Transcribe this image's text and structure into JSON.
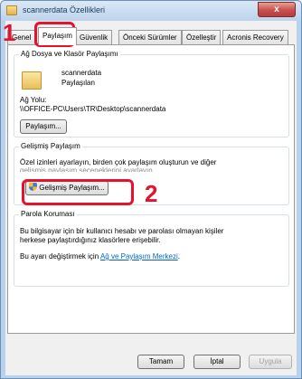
{
  "window": {
    "title": "scannerdata Özellikleri",
    "close_symbol": "x"
  },
  "tabs": [
    "Genel",
    "Paylaşım",
    "Güvenlik",
    "Önceki Sürümler",
    "Özelleştir",
    "Acronis Recovery"
  ],
  "network_share": {
    "group_title": "Ağ Dosya ve Klasör Paylaşımı",
    "folder_name": "scannerdata",
    "folder_status": "Paylaşılan",
    "path_label": "Ağ Yolu:",
    "path_value": "\\\\OFFICE-PC\\Users\\TR\\Desktop\\scannerdata",
    "share_button": "Paylaşım..."
  },
  "advanced_share": {
    "group_title": "Gelişmiş Paylaşım",
    "description_1": "Özel izinleri ayarlayın, birden çok paylaşım oluşturun ve diğer",
    "description_2": "gelişmiş paylaşım seçeneklerini ayarlayın.",
    "button": "Gelişmiş Paylaşım..."
  },
  "password_protection": {
    "group_title": "Parola Koruması",
    "description_1": "Bu bilgisayar için bir kullanıcı hesabı ve parolası olmayan kişiler",
    "description_2": "herkese paylaştırdığınız klasörlere erişebilir.",
    "change_text": "Bu ayarı değiştirmek için",
    "link_text": "Ağ ve Paylaşım Merkezi",
    "link_suffix": "."
  },
  "footer": {
    "ok": "Tamam",
    "cancel": "İptal",
    "apply": "Uygula"
  },
  "annotations": {
    "step1": "1",
    "step2": "2"
  },
  "colors": {
    "annotation": "#e8112d",
    "link": "#0066cc"
  }
}
